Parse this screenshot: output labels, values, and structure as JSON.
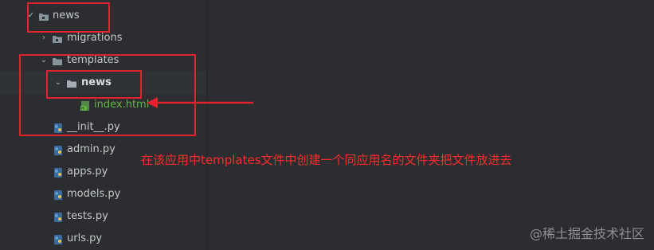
{
  "tree": {
    "root": {
      "label": "news",
      "expanded": true
    },
    "items": [
      {
        "label": "migrations",
        "type": "folder",
        "expanded": false
      },
      {
        "label": "templates",
        "type": "folder",
        "expanded": true
      },
      {
        "label": "news",
        "type": "folder",
        "expanded": true
      },
      {
        "label": "index.html",
        "type": "html-file"
      },
      {
        "label": "__init__.py",
        "type": "python-file"
      },
      {
        "label": "admin.py",
        "type": "python-file"
      },
      {
        "label": "apps.py",
        "type": "python-file"
      },
      {
        "label": "models.py",
        "type": "python-file"
      },
      {
        "label": "tests.py",
        "type": "python-file"
      },
      {
        "label": "urls.py",
        "type": "python-file"
      }
    ]
  },
  "annotation": {
    "text": "在该应用中templates文件中创建一个同应用名的文件夹把文件放进去"
  },
  "watermark": {
    "text": "@稀土掘金技术社区"
  },
  "colors": {
    "background": "#2b2d30",
    "annotation_red": "#e0232d",
    "html_file_green": "#62b543"
  }
}
